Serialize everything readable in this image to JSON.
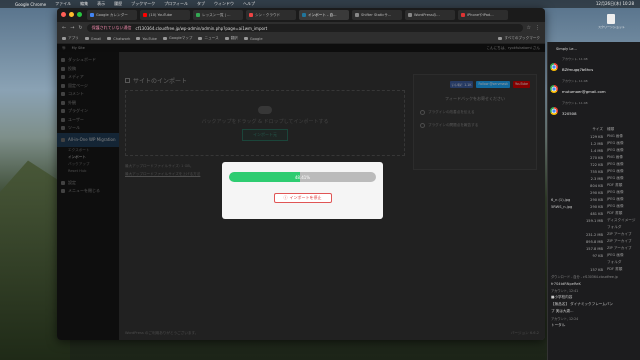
{
  "menubar": {
    "app": "Google Chrome",
    "items": [
      "ファイル",
      "編集",
      "表示",
      "履歴",
      "ブックマーク",
      "プロフィール",
      "タブ",
      "ウィンドウ",
      "ヘルプ"
    ],
    "clock": "12月26日(木) 10:28"
  },
  "tabs": [
    {
      "label": "Google カレンダー",
      "color": "#4285f4"
    },
    {
      "label": "(10) YouTube",
      "color": "#ff0000"
    },
    {
      "label": "レッスン一覧 | ...",
      "color": "#34a853"
    },
    {
      "label": "シン・クラウド",
      "color": "#e44"
    },
    {
      "label": "インポート - 自...",
      "color": "#21759b",
      "active": true
    },
    {
      "label": "Shifter Staticサ...",
      "color": "#888"
    },
    {
      "label": "WordPressの...",
      "color": "#888"
    },
    {
      "label": "iPhoneやiPad...",
      "color": "#d33"
    }
  ],
  "address": {
    "warning": "保護されていない通信",
    "url": "cf130364.cloudfree.jp/wp-admin/admin.php?page=ai1wm_import"
  },
  "bookmarks": [
    "アプリ",
    "Gmail",
    "Chatwork",
    "YouTube",
    "Googleマップ",
    "ニュース",
    "翻訳",
    "Google",
    "すべてのブックマーク"
  ],
  "adminbar": {
    "site": "My Site",
    "greeting": "こんにちは、ryokfukatomi さん"
  },
  "sidebar": {
    "items": [
      {
        "label": "ダッシュボード"
      },
      {
        "label": "投稿"
      },
      {
        "label": "メディア"
      },
      {
        "label": "固定ページ"
      },
      {
        "label": "コメント"
      },
      {
        "label": "外観"
      },
      {
        "label": "プラグイン"
      },
      {
        "label": "ユーザー"
      },
      {
        "label": "ツール"
      },
      {
        "label": "All-in-One WP Migration",
        "active": true
      }
    ],
    "subitems": [
      "エクスポート",
      "インポート",
      "バックアップ",
      "Reset Hub"
    ],
    "bottom": [
      "設定",
      "メニューを閉じる"
    ]
  },
  "main": {
    "title": "サイトのインポート",
    "drop_text": "バックアップをドラッグ & ドロップしてインポートする",
    "import_button": "インポート元",
    "limit_text": "最大アップロードファイルサイズ: 1 GB。",
    "limit_link": "最大アップロードファイルサイズを上げる方法"
  },
  "feedback": {
    "socials": [
      {
        "label": "いいね！1.1K",
        "color": "#3b5998"
      },
      {
        "label": "Follow @servmask",
        "color": "#1da1f2"
      },
      {
        "label": "YouTube",
        "color": "#cc0000"
      }
    ],
    "title": "フィードバックをお寄せください",
    "options": [
      "プラグインの改善点を伝える",
      "プラグインの問題点を報告する"
    ]
  },
  "footer": {
    "left": "WordPress のご利用ありがとうございます。",
    "version": "バージョン 6.6.2"
  },
  "modal": {
    "progress_percent": 48.41,
    "progress_label": "48.41%",
    "stop_label": "インポートを停止"
  },
  "download_panel": {
    "title": "Simply Le...",
    "emails": [
      {
        "meta": "アカウント, 11:48",
        "value": "BZfmugq7b6hcs"
      },
      {
        "meta": "アカウント, 11:48",
        "value": "mutumoer@gmail.com"
      },
      {
        "meta": "アカウント, 11:48",
        "value": "320508"
      }
    ],
    "headers": [
      "サイズ",
      "種類"
    ],
    "files": [
      {
        "name": "",
        "size": "129 KB",
        "kind": "PNG 画像"
      },
      {
        "name": "",
        "size": "1.2 MB",
        "kind": "JPEG 画像"
      },
      {
        "name": "",
        "size": "1.4 MB",
        "kind": "JPEG 画像"
      },
      {
        "name": "",
        "size": "270 KB",
        "kind": "PNG 画像"
      },
      {
        "name": "",
        "size": "722 KB",
        "kind": "JPEG 画像"
      },
      {
        "name": "",
        "size": "755 KB",
        "kind": "JPEG 画像"
      },
      {
        "name": "",
        "size": "2.3 MB",
        "kind": "JPEG 画像"
      },
      {
        "name": "",
        "size": "804 KB",
        "kind": "PDF 書類"
      },
      {
        "name": "",
        "size": "290 KB",
        "kind": "JPEG 画像"
      },
      {
        "name": "6_n (1).jpg",
        "size": "290 KB",
        "kind": "JPEG 画像"
      },
      {
        "name": "5RWS_n.jpg",
        "size": "290 KB",
        "kind": "JPEG 画像"
      },
      {
        "name": "",
        "size": "481 KB",
        "kind": "PDF 書類"
      },
      {
        "name": "",
        "size": "159.1 MB",
        "kind": "ディスクイメージ"
      },
      {
        "name": "",
        "size": "",
        "kind": "フォルダ"
      },
      {
        "name": "",
        "size": "231.2 MB",
        "kind": "ZIP アーカイブ"
      },
      {
        "name": "",
        "size": "895.8 MB",
        "kind": "ZIP アーカイブ"
      },
      {
        "name": "",
        "size": "157.8 MB",
        "kind": "ZIP アーカイブ"
      },
      {
        "name": "",
        "size": "97 KB",
        "kind": "JPEG 画像"
      },
      {
        "name": "",
        "size": "",
        "kind": "フォルダ"
      },
      {
        "name": "",
        "size": "157 KB",
        "kind": "PDF 書類"
      }
    ],
    "notes": [
      {
        "text": "ダウンロード - 自分 - cf130364.cloudfree.jp",
        "dim": true
      },
      {
        "text": "fr7S4tdRNpeReK",
        "dim": false
      },
      {
        "text": "アカウント, 12:41",
        "dim": true
      },
      {
        "text": "■小学校内容",
        "dim": false
      },
      {
        "text": "【無品名】 ダイナミックフレームバン",
        "dim": false
      },
      {
        "text": "プ 実は大歳...",
        "dim": false
      },
      {
        "text": "アカウント, 12:24",
        "dim": true
      },
      {
        "text": "トータル",
        "dim": false
      }
    ]
  },
  "desktop_file": {
    "label": "スクリーンショット"
  }
}
